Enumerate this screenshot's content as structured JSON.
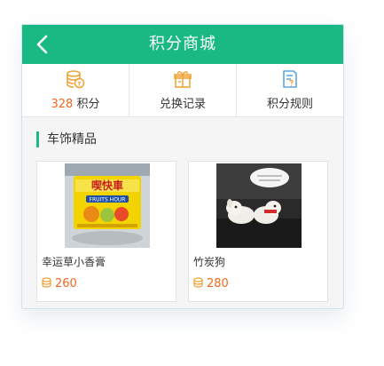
{
  "header": {
    "title": "积分商城",
    "back_icon": "back-arrow-icon"
  },
  "tabs": [
    {
      "icon": "coin-stack-icon",
      "value": "328",
      "label": "积分"
    },
    {
      "icon": "gift-icon",
      "label": "兑换记录"
    },
    {
      "icon": "rules-document-icon",
      "label": "积分规则"
    }
  ],
  "section": {
    "title": "车饰精品"
  },
  "products": [
    {
      "name": "幸运草小香膏",
      "price": "260",
      "image_text": "喫快車",
      "image_sub": "FRUITS HOUR"
    },
    {
      "name": "竹炭狗",
      "price": "280"
    }
  ],
  "colors": {
    "brand": "#1ab882",
    "price": "#f06a1e",
    "icon": "#f0a43a"
  }
}
